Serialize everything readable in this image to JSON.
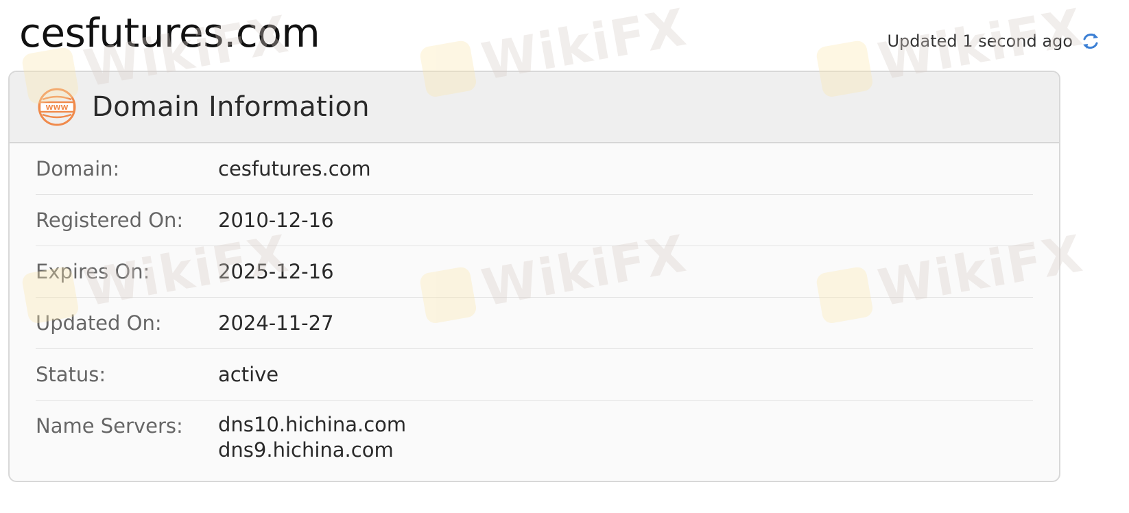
{
  "header": {
    "domain_title": "cesfutures.com",
    "updated_text": "Updated 1 second ago",
    "refresh_icon": "refresh-icon",
    "refresh_color": "#3b7fd4"
  },
  "card": {
    "title": "Domain Information",
    "icon": "www-icon",
    "icon_color": "#f08a4b",
    "rows": [
      {
        "label": "Domain:",
        "value": "cesfutures.com"
      },
      {
        "label": "Registered On:",
        "value": "2010-12-16"
      },
      {
        "label": "Expires On:",
        "value": "2025-12-16"
      },
      {
        "label": "Updated On:",
        "value": "2024-11-27"
      },
      {
        "label": "Status:",
        "value": "active"
      },
      {
        "label": "Name Servers:",
        "values": [
          "dns10.hichina.com",
          "dns9.hichina.com"
        ]
      }
    ]
  },
  "watermark": {
    "text": "WikiFX",
    "logo_color": "#fbe7b0"
  }
}
